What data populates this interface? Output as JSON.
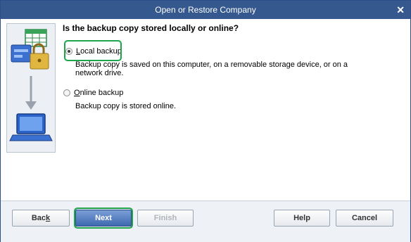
{
  "window": {
    "title": "Open or Restore Company",
    "close_glyph": "✕"
  },
  "question": "Is the backup copy stored locally or online?",
  "options": [
    {
      "key": "L",
      "label_rest": "ocal backup",
      "checked": true,
      "description_line1": "Backup copy is saved on this computer, on a removable storage device, or on a",
      "description_line2": "network drive."
    },
    {
      "key": "O",
      "label_rest": "nline backup",
      "checked": false,
      "description_line1": "Backup copy is stored online."
    }
  ],
  "buttons": {
    "back": {
      "pre": "Bac",
      "key": "k",
      "post": ""
    },
    "next": {
      "label": "Next"
    },
    "finish": {
      "label": "Finish"
    },
    "help": {
      "label": "Help"
    },
    "cancel": {
      "label": "Cancel"
    }
  },
  "colors": {
    "titlebar": "#35598f",
    "highlight": "#1fa44b",
    "primary_button": "#3f69b0"
  },
  "icons": [
    "spreadsheet-icon",
    "server-icon",
    "lock-icon",
    "down-arrow-icon",
    "laptop-icon"
  ]
}
